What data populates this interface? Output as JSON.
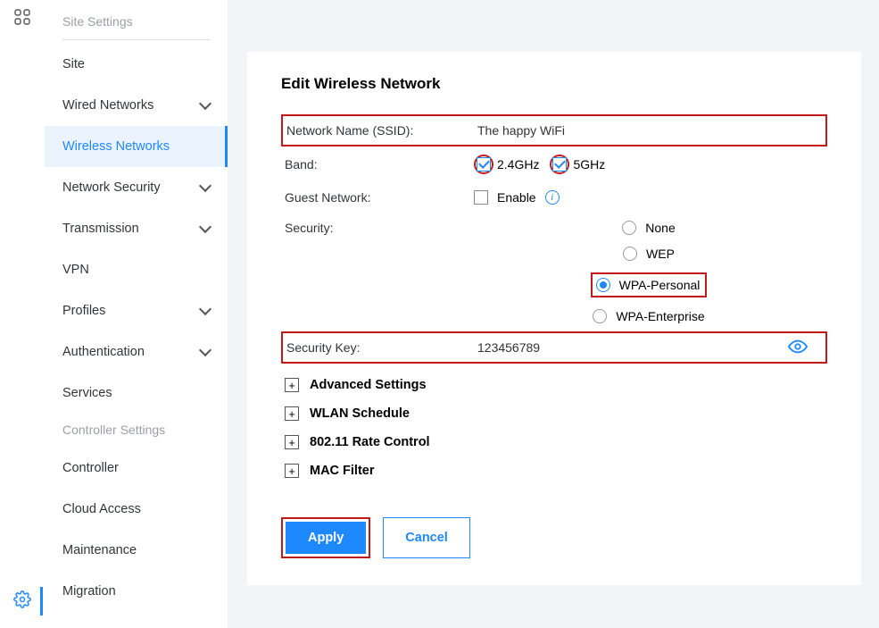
{
  "sidebar": {
    "section1_title": "Site Settings",
    "items1": [
      {
        "label": "Site",
        "expandable": false
      },
      {
        "label": "Wired Networks",
        "expandable": true
      },
      {
        "label": "Wireless Networks",
        "expandable": false,
        "active": true
      },
      {
        "label": "Network Security",
        "expandable": true
      },
      {
        "label": "Transmission",
        "expandable": true
      },
      {
        "label": "VPN",
        "expandable": false
      },
      {
        "label": "Profiles",
        "expandable": true
      },
      {
        "label": "Authentication",
        "expandable": true
      },
      {
        "label": "Services",
        "expandable": false
      }
    ],
    "section2_title": "Controller Settings",
    "items2": [
      {
        "label": "Controller"
      },
      {
        "label": "Cloud Access"
      },
      {
        "label": "Maintenance"
      },
      {
        "label": "Migration"
      }
    ]
  },
  "page": {
    "title": "Edit Wireless Network",
    "ssid_label": "Network Name (SSID):",
    "ssid_value": "The happy WiFi",
    "band_label": "Band:",
    "band_24": "2.4GHz",
    "band_5": "5GHz",
    "band_24_checked": true,
    "band_5_checked": true,
    "guest_label": "Guest Network:",
    "guest_enable": "Enable",
    "guest_checked": false,
    "security_label": "Security:",
    "security_options": [
      "None",
      "WEP",
      "WPA-Personal",
      "WPA-Enterprise"
    ],
    "security_selected": "WPA-Personal",
    "key_label": "Security Key:",
    "key_value": "123456789",
    "expanders": [
      "Advanced Settings",
      "WLAN Schedule",
      "802.11 Rate Control",
      "MAC Filter"
    ],
    "apply_btn": "Apply",
    "cancel_btn": "Cancel"
  }
}
